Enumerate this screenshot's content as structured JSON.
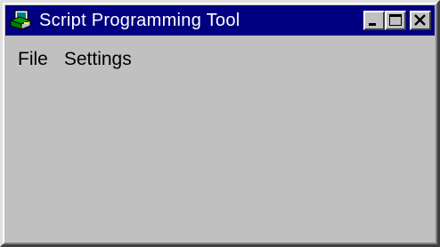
{
  "window": {
    "title": "Script Programming Tool",
    "icon": "app-window-icon",
    "colors": {
      "titlebar": "#000080",
      "title_text": "#ffffff",
      "face": "#c0c0c0"
    }
  },
  "title_buttons": {
    "minimize_icon": "minimize-icon",
    "maximize_icon": "maximize-icon",
    "close_icon": "close-icon"
  },
  "menu": {
    "items": [
      {
        "label": "File"
      },
      {
        "label": "Settings"
      }
    ]
  }
}
